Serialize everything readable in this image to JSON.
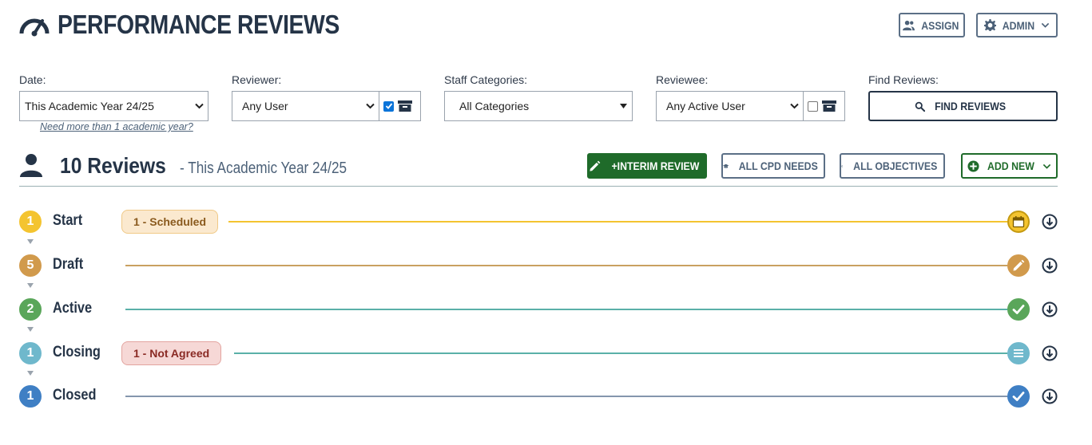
{
  "header": {
    "title": "PERFORMANCE REVIEWS",
    "assign_label": "ASSIGN",
    "admin_label": "ADMIN"
  },
  "filters": {
    "date": {
      "label": "Date:",
      "value": "This Academic Year 24/25",
      "help": "Need more than 1 academic year?"
    },
    "reviewer": {
      "label": "Reviewer:",
      "value": "Any User",
      "checked": true
    },
    "staff_categories": {
      "label": "Staff Categories:",
      "value": "All Categories"
    },
    "reviewee": {
      "label": "Reviewee:",
      "value": "Any Active User",
      "checked": false
    },
    "find": {
      "label": "Find Reviews:",
      "button": "FIND REVIEWS"
    }
  },
  "summary": {
    "count_text": "10 Reviews",
    "period_text": "- This Academic Year 24/25",
    "interim_label": "+INTERIM REVIEW",
    "cpd_label": "ALL CPD NEEDS",
    "objectives_label": "ALL OBJECTIVES",
    "add_new_label": "ADD NEW"
  },
  "stages": [
    {
      "count": "1",
      "name": "Start",
      "pill": "1 - Scheduled",
      "color": "#f4c430",
      "icon": "calendar-icon"
    },
    {
      "count": "5",
      "name": "Draft",
      "pill": "",
      "color": "#d19a4c",
      "icon": "pencil-icon"
    },
    {
      "count": "2",
      "name": "Active",
      "pill": "",
      "color": "#5aa65a",
      "icon": "check-icon"
    },
    {
      "count": "1",
      "name": "Closing",
      "pill": "1 - Not Agreed",
      "color": "#6fb8cc",
      "icon": "list-icon"
    },
    {
      "count": "1",
      "name": "Closed",
      "pill": "",
      "color": "#3f7fc4",
      "icon": "check-icon"
    }
  ],
  "colors": {
    "navy": "#253447",
    "slate": "#4c6178",
    "green": "#1f6b2a",
    "scheduled_bg": "#fbe9cf",
    "not_agreed_bg": "#f6d8d6"
  }
}
